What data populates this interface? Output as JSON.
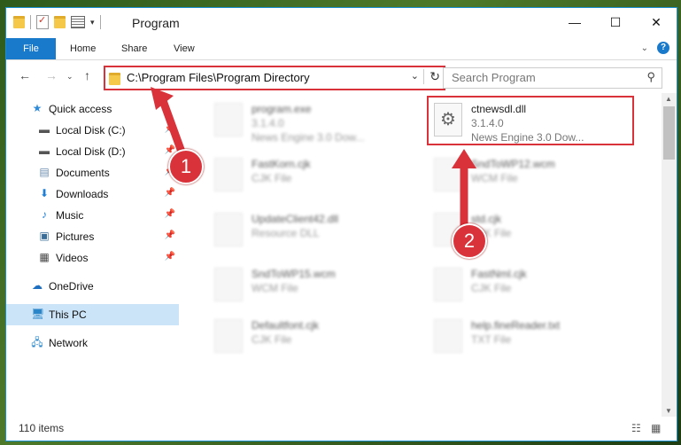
{
  "window": {
    "title": "Program",
    "controls": {
      "minimize": "—",
      "maximize": "☐",
      "close": "✕"
    }
  },
  "ribbon": {
    "tabs": [
      "File",
      "Home",
      "Share",
      "View"
    ]
  },
  "address_bar": {
    "path": "C:\\Program Files\\Program Directory",
    "search_placeholder": "Search Program"
  },
  "sidebar": {
    "items": [
      {
        "label": "Quick access",
        "icon": "star-icon"
      },
      {
        "label": "Local Disk (C:)",
        "icon": "drive-icon",
        "pinned": true
      },
      {
        "label": "Local Disk (D:)",
        "icon": "drive-icon",
        "pinned": true
      },
      {
        "label": "Documents",
        "icon": "documents-icon",
        "pinned": true
      },
      {
        "label": "Downloads",
        "icon": "download-icon",
        "pinned": true
      },
      {
        "label": "Music",
        "icon": "music-icon",
        "pinned": true
      },
      {
        "label": "Pictures",
        "icon": "pictures-icon",
        "pinned": true
      },
      {
        "label": "Videos",
        "icon": "videos-icon",
        "pinned": true
      },
      {
        "label": "OneDrive",
        "icon": "cloud-icon"
      },
      {
        "label": "This PC",
        "icon": "computer-icon",
        "selected": true
      },
      {
        "label": "Network",
        "icon": "network-icon"
      }
    ]
  },
  "files": {
    "highlighted": {
      "name": "ctnewsdl.dll",
      "line1": "3.1.4.0",
      "line2": "News Engine 3.0 Dow..."
    },
    "blurred": [
      {
        "name": "program.exe",
        "line1": "3.1.4.0",
        "line2": "News Engine 3.0 Dow..."
      },
      {
        "name": "FastKorn.cjk",
        "line1": "CJK File"
      },
      {
        "name": "SndToWP12.wcm",
        "line1": "WCM File"
      },
      {
        "name": "UpdateClient42.dll",
        "line1": "Resource DLL"
      },
      {
        "name": "std.cjk",
        "line1": "CJK File"
      },
      {
        "name": "SndToWP15.wcm",
        "line1": "WCM File"
      },
      {
        "name": "FastNml.cjk",
        "line1": "CJK File"
      },
      {
        "name": "Defaultfont.cjk",
        "line1": "CJK File"
      },
      {
        "name": "help.fineReader.txt",
        "line1": "TXT File"
      }
    ]
  },
  "status": {
    "items": "110 items"
  },
  "callouts": [
    "1",
    "2"
  ],
  "colors": {
    "accent": "#1979ca",
    "highlight": "#d9323a",
    "selected": "#cce4f7"
  }
}
